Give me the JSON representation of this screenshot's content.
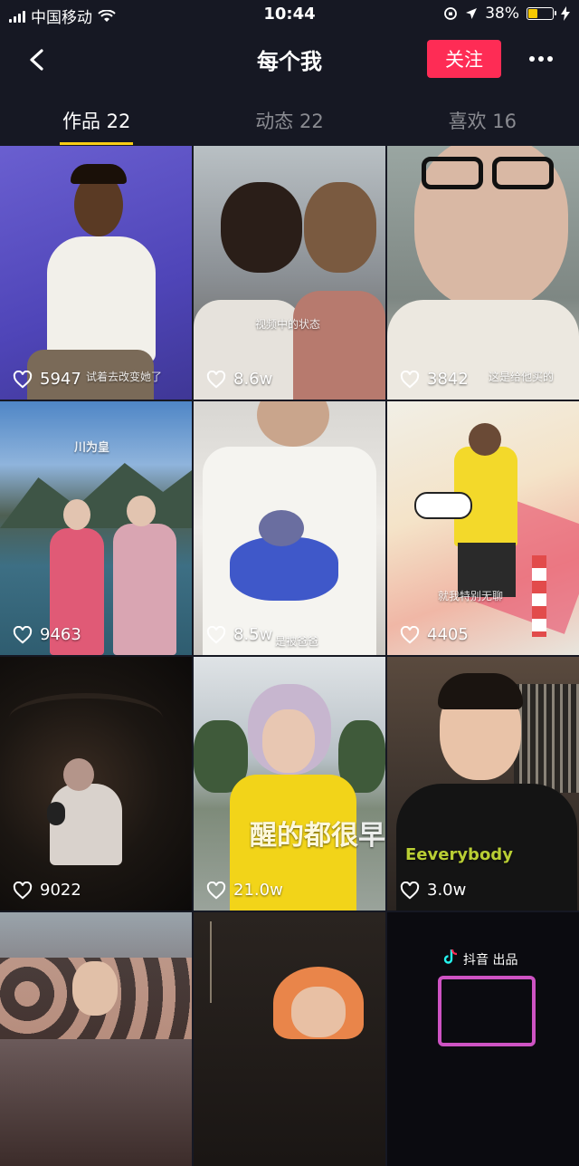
{
  "status_bar": {
    "carrier": "中国移动",
    "time": "10:44",
    "battery": "38%",
    "battery_level": 0.38
  },
  "header": {
    "title": "每个我",
    "follow_label": "关注"
  },
  "tabs": [
    {
      "label": "作品 22",
      "active": true
    },
    {
      "label": "动态 22",
      "active": false
    },
    {
      "label": "喜欢 16",
      "active": false
    }
  ],
  "videos": [
    {
      "likes": "5947",
      "caption": "试着去改变她了"
    },
    {
      "likes": "8.6w",
      "caption": "视频中的状态"
    },
    {
      "likes": "3842",
      "caption": "这是给他买的"
    },
    {
      "likes": "9463",
      "caption": "川为皇"
    },
    {
      "likes": "8.5w",
      "caption": "是被爸爸"
    },
    {
      "likes": "4405",
      "caption": "就我特别无聊"
    },
    {
      "likes": "9022",
      "caption": ""
    },
    {
      "likes": "21.0w",
      "caption": "醒的都很早"
    },
    {
      "likes": "3.0w",
      "caption": "Eeverybody"
    },
    {
      "likes": "",
      "caption": ""
    },
    {
      "likes": "",
      "caption": ""
    },
    {
      "likes": "",
      "caption": "抖音 出品"
    }
  ],
  "colors": {
    "accent": "#fe2c55",
    "tab_indicator": "#face15",
    "background": "#161823"
  }
}
